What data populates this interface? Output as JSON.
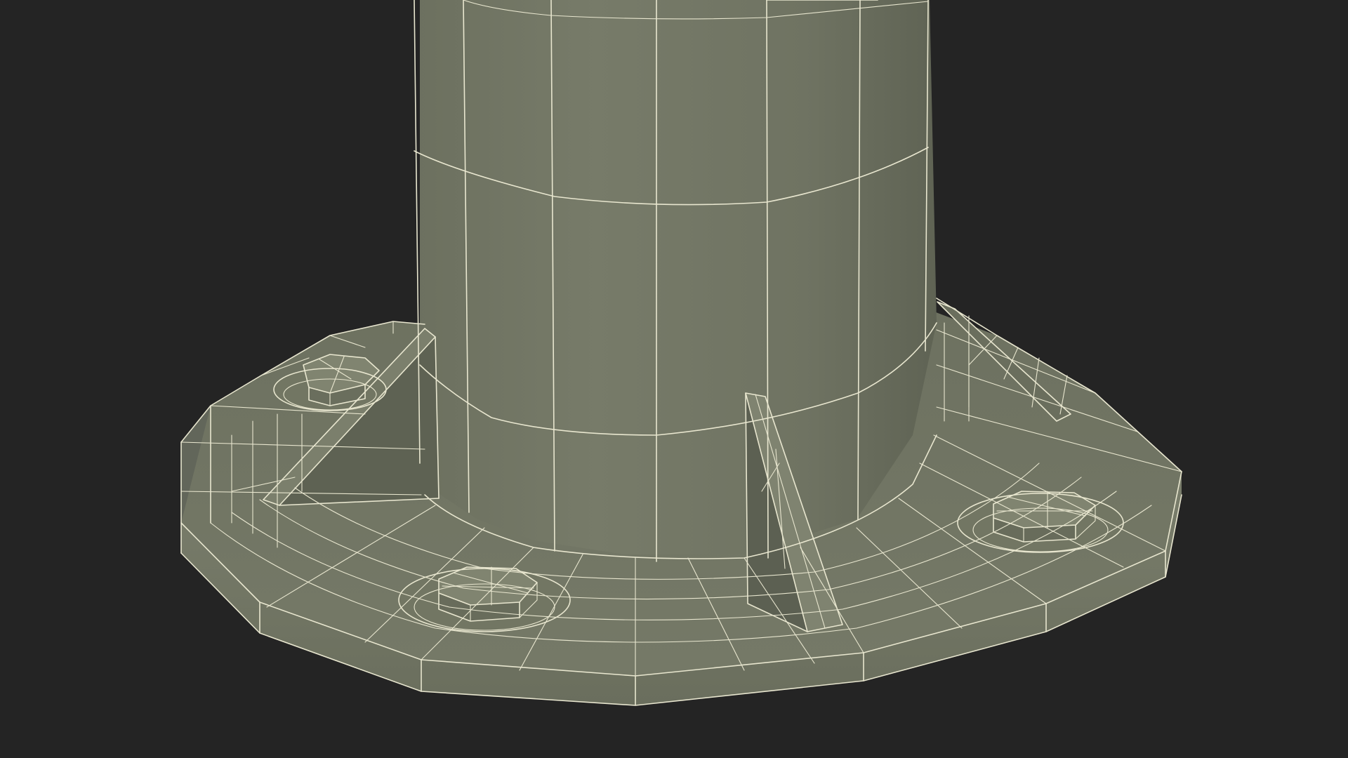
{
  "scene": {
    "background_color": "#242424",
    "model_color": "#6e7262",
    "wire_color": "#e8e6cf",
    "subject": "wireframe-base-plate-with-bolts"
  }
}
